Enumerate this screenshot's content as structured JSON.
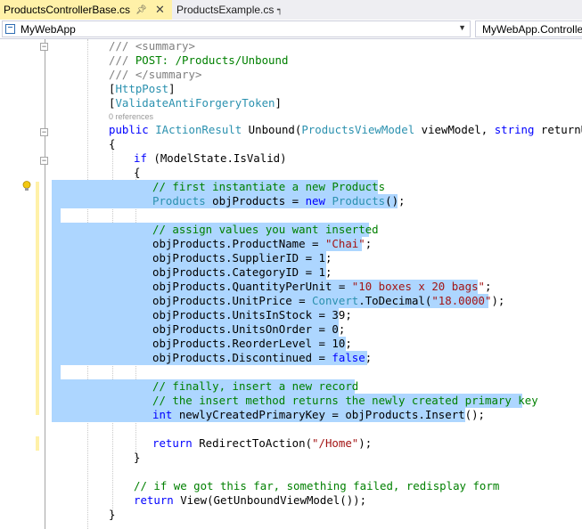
{
  "tabs": [
    {
      "label": "ProductsControllerBase.cs",
      "active": true,
      "icons": [
        "pin-icon",
        "close-icon"
      ]
    },
    {
      "label": "ProductsExample.cs",
      "active": false,
      "icons": [
        "pin-icon"
      ]
    }
  ],
  "navbar": {
    "project": "MyWebApp",
    "class": "MyWebApp.Controllers"
  },
  "code_lens": "0 references",
  "code": {
    "l1": "/// <summary>",
    "l2a": "/// ",
    "l2b": "POST: /Products/Unbound",
    "l3": "/// </summary>",
    "l4a": "[",
    "l4b": "HttpPost",
    "l4c": "]",
    "l5a": "[",
    "l5b": "ValidateAntiForgeryToken",
    "l5c": "]",
    "l6a": "public ",
    "l6b": "IActionResult",
    "l6c": " Unbound(",
    "l6d": "ProductsViewModel",
    "l6e": " viewModel, ",
    "l6f": "string",
    "l6g": " returnUrl)",
    "l7": "{",
    "l8a": "if",
    "l8b": " (ModelState.IsValid)",
    "l9": "{",
    "l10": "// first instantiate a new Products",
    "l11a": "Products",
    "l11b": " objProducts = ",
    "l11c": "new ",
    "l11d": "Products",
    "l11e": "();",
    "l12": "// assign values you want inserted",
    "l13a": "objProducts.ProductName = ",
    "l13b": "\"Chai\"",
    "l13c": ";",
    "l14": "objProducts.SupplierID = 1;",
    "l15": "objProducts.CategoryID = 1;",
    "l16a": "objProducts.QuantityPerUnit = ",
    "l16b": "\"10 boxes x 20 bags\"",
    "l16c": ";",
    "l17a": "objProducts.UnitPrice = ",
    "l17b": "Convert",
    "l17c": ".ToDecimal(",
    "l17d": "\"18.0000\"",
    "l17e": ");",
    "l18": "objProducts.UnitsInStock = 39;",
    "l19": "objProducts.UnitsOnOrder = 0;",
    "l20": "objProducts.ReorderLevel = 10;",
    "l21a": "objProducts.Discontinued = ",
    "l21b": "false",
    "l21c": ";",
    "l22": "// finally, insert a new record",
    "l23": "// the insert method returns the newly created primary key",
    "l24a": "int",
    "l24b": " newlyCreatedPrimaryKey = objProducts.Insert();",
    "l25a": "return",
    "l25b": " RedirectToAction(",
    "l25c": "\"/Home\"",
    "l25d": ");",
    "l26": "}",
    "l27": "// if we got this far, something failed, redisplay form",
    "l28a": "return",
    "l28b": " View(GetUnboundViewModel());",
    "l29": "}"
  },
  "colors": {
    "comment": "#008000",
    "keyword": "#0000ff",
    "type": "#2b91af",
    "string": "#a31515",
    "selection": "#add6ff",
    "active_tab": "#fff1a8"
  }
}
